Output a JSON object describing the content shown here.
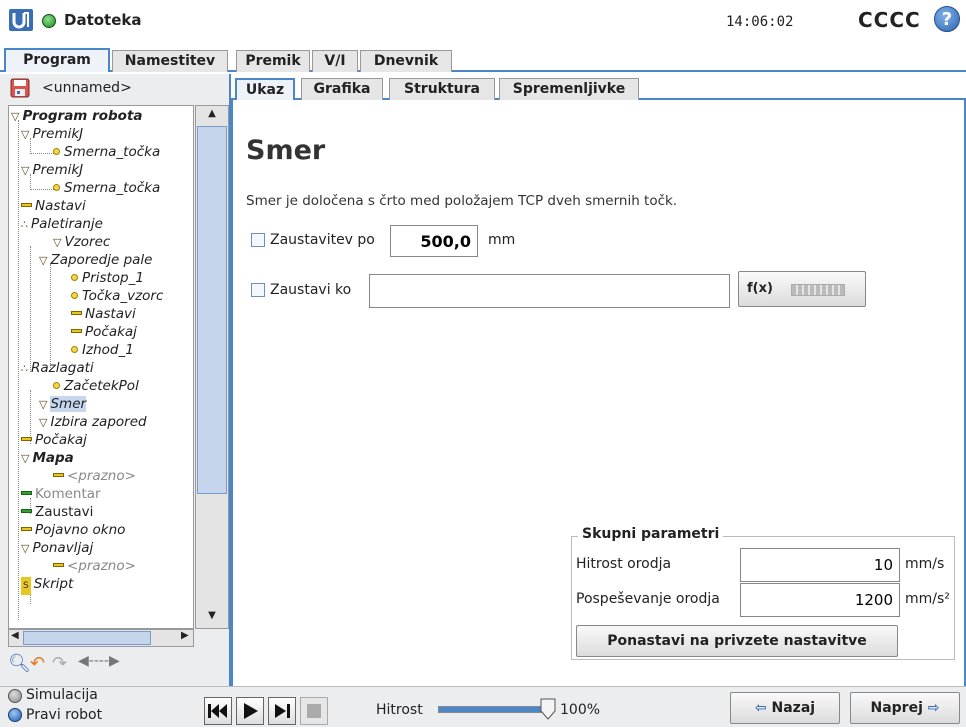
{
  "topbar": {
    "title": "Datoteka",
    "time": "14:06:02",
    "robot_name": "CCCC",
    "help_icon": "?"
  },
  "main_tabs": [
    "Program",
    "Namestitev",
    "Premik",
    "V/I",
    "Dnevnik"
  ],
  "program": {
    "name": "<unnamed>"
  },
  "sub_tabs": [
    "Ukaz",
    "Grafika",
    "Struktura",
    "Spremenljivke"
  ],
  "tree": [
    {
      "label": "Program robota"
    },
    {
      "label": "PremikJ"
    },
    {
      "label": "Smerna_točka"
    },
    {
      "label": "PremikJ"
    },
    {
      "label": "Smerna_točka"
    },
    {
      "label": "Nastavi"
    },
    {
      "label": "Paletiranje"
    },
    {
      "label": "Vzorec"
    },
    {
      "label": "Zaporedje pale"
    },
    {
      "label": "Pristop_1"
    },
    {
      "label": "Točka_vzorc"
    },
    {
      "label": "Nastavi"
    },
    {
      "label": "Počakaj"
    },
    {
      "label": "Izhod_1"
    },
    {
      "label": "Razlagati"
    },
    {
      "label": "ZačetekPol"
    },
    {
      "label": "Smer"
    },
    {
      "label": "Izbira zapored"
    },
    {
      "label": "Počakaj"
    },
    {
      "label": "Mapa"
    },
    {
      "label": "<prazno>"
    },
    {
      "label": "Komentar"
    },
    {
      "label": "Zaustavi"
    },
    {
      "label": "Pojavno okno"
    },
    {
      "label": "Ponavljaj"
    },
    {
      "label": "<prazno>"
    },
    {
      "label": "Skript"
    }
  ],
  "content": {
    "title": "Smer",
    "description": "Smer je določena s črto med položajem TCP dveh smernih točk.",
    "stop_after_label": "Zaustavitev po",
    "stop_after_value": "500,0",
    "stop_after_unit": "mm",
    "stop_when_label": "Zaustavi ko",
    "stop_when_value": "",
    "fx_label": "f(x)"
  },
  "shared_params": {
    "title": "Skupni parametri",
    "tool_speed_label": "Hitrost orodja",
    "tool_speed_value": "10",
    "tool_speed_unit": "mm/s",
    "tool_accel_label": "Pospeševanje orodja",
    "tool_accel_value": "1200",
    "tool_accel_unit": "mm/s²",
    "reset_label": "Ponastavi na privzete nastavitve"
  },
  "bottom": {
    "simulation_label": "Simulacija",
    "real_robot_label": "Pravi robot",
    "speed_label": "Hitrost",
    "speed_value": "100%",
    "speed_fraction": 1.0,
    "back_label": "Nazaj",
    "next_label": "Naprej"
  },
  "colors": {
    "accent": "#4a86c8",
    "status_green": "#2e9e2e",
    "logo_blue": "#3a6fb5"
  }
}
